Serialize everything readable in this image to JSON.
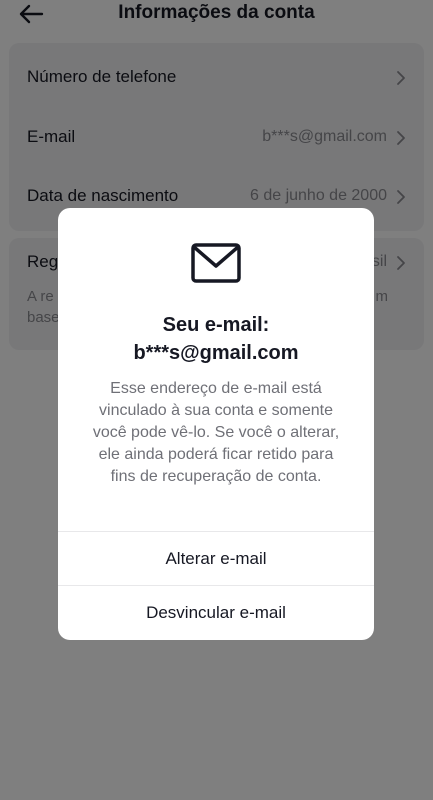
{
  "header": {
    "title": "Informações da conta",
    "back_icon": "arrow-left-icon"
  },
  "account_rows": [
    {
      "label": "Número de telefone",
      "value": ""
    },
    {
      "label": "E-mail",
      "value": "b***s@gmail.com"
    },
    {
      "label": "Data de nascimento",
      "value": "6 de junho de 2000"
    }
  ],
  "region_row": {
    "label": "Reg",
    "value": "sil",
    "desc_line1": "A re",
    "desc_line1_end": "m",
    "desc_line2": "base"
  },
  "modal": {
    "icon": "envelope-icon",
    "title_line1": "Seu e-mail:",
    "title_line2": "b***s@gmail.com",
    "description": "Esse endereço de e-mail está vinculado à sua conta e somente você pode vê-lo. Se você o alterar, ele ainda poderá ficar retido para fins de recuperação de conta.",
    "change_label": "Alterar e-mail",
    "unlink_label": "Desvincular e-mail"
  },
  "colors": {
    "overlay": "#00000080",
    "card": "#f1f1f2",
    "text": "#161823",
    "muted": "#8a8b91"
  }
}
